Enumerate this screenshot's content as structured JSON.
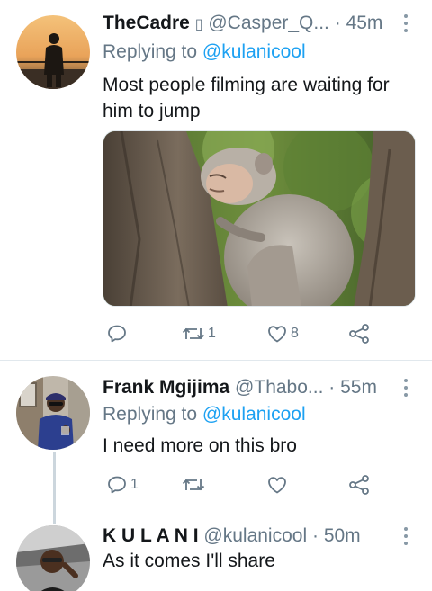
{
  "tweets": [
    {
      "name": "TheCadre",
      "name_emoji": "▯",
      "handle": "@Casper_Q...",
      "separator": "·",
      "time": "45m",
      "reply_prefix": "Replying to",
      "reply_to": "@kulanicool",
      "text": "Most people filming are waiting for him to jump",
      "media_alt_icon": "monkey-photo",
      "stats": {
        "replies": "",
        "retweets": "1",
        "likes": "8"
      }
    },
    {
      "name": "Frank Mgijima",
      "handle": "@Thabo...",
      "separator": "·",
      "time": "55m",
      "reply_prefix": "Replying to",
      "reply_to": "@kulanicool",
      "text": "I need more on this bro",
      "stats": {
        "replies": "1",
        "retweets": "",
        "likes": ""
      }
    },
    {
      "name": "K U L A N I",
      "handle": "@kulanicool",
      "separator": "·",
      "time": "50m",
      "text": "As it comes I'll share"
    }
  ],
  "colors": {
    "link": "#1da1f2",
    "muted": "#657786",
    "text": "#14171a",
    "divider": "#e1e8ed"
  },
  "icons": [
    "reply-icon",
    "retweet-icon",
    "like-icon",
    "share-icon",
    "more-icon"
  ]
}
